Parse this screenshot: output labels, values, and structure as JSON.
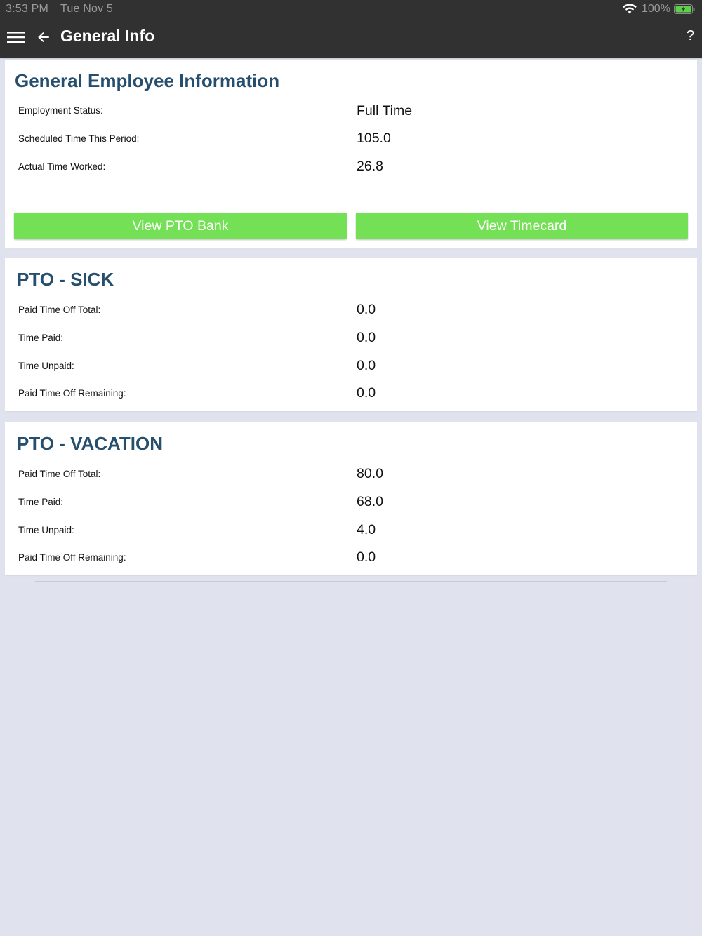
{
  "status_bar": {
    "time": "3:53 PM",
    "date": "Tue Nov 5",
    "battery_percent": "100%"
  },
  "nav": {
    "title": "General Info",
    "help_label": "?",
    "menu_icon": "hamburger-menu-icon",
    "back_icon": "back-arrow-icon"
  },
  "general": {
    "title": "General Employee Information",
    "rows": [
      {
        "label": "Employment Status:",
        "value": "Full Time"
      },
      {
        "label": "Scheduled Time This Period:",
        "value": "105.0"
      },
      {
        "label": "Actual Time Worked:",
        "value": "26.8"
      }
    ],
    "buttons": {
      "pto_bank": "View PTO Bank",
      "timecard": "View Timecard"
    }
  },
  "pto_sick": {
    "title": "PTO - SICK",
    "rows": [
      {
        "label": "Paid Time Off Total:",
        "value": "0.0"
      },
      {
        "label": "Time Paid:",
        "value": "0.0"
      },
      {
        "label": "Time Unpaid:",
        "value": "0.0"
      },
      {
        "label": "Paid Time Off Remaining:",
        "value": "0.0"
      }
    ]
  },
  "pto_vacation": {
    "title": "PTO - VACATION",
    "rows": [
      {
        "label": "Paid Time Off Total:",
        "value": "80.0"
      },
      {
        "label": "Time Paid:",
        "value": "68.0"
      },
      {
        "label": "Time Unpaid:",
        "value": "4.0"
      },
      {
        "label": "Paid Time Off Remaining:",
        "value": "0.0"
      }
    ]
  },
  "colors": {
    "nav_background": "#313131",
    "section_title": "#264f6d",
    "button_green": "#74e055",
    "page_background": "#e0e3ee"
  }
}
